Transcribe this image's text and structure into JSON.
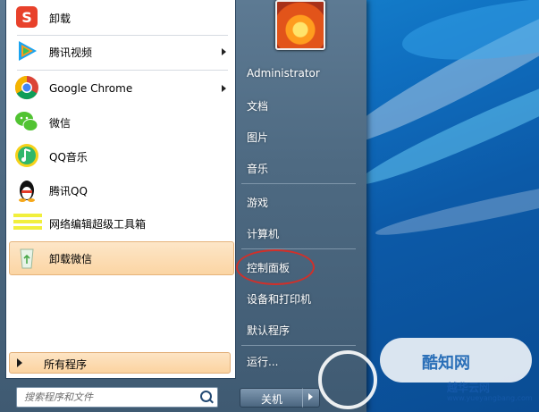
{
  "left_pane": {
    "programs": [
      {
        "label": "卸载",
        "icon": "sogou-uninstall-icon",
        "has_submenu": false
      },
      {
        "label": "腾讯视频",
        "icon": "tencent-video-icon",
        "has_submenu": true
      },
      {
        "label": "Google Chrome",
        "icon": "chrome-icon",
        "has_submenu": true
      },
      {
        "label": "微信",
        "icon": "wechat-icon",
        "has_submenu": false
      },
      {
        "label": "QQ音乐",
        "icon": "qq-music-icon",
        "has_submenu": false
      },
      {
        "label": "腾讯QQ",
        "icon": "qq-penguin-icon",
        "has_submenu": false
      },
      {
        "label": "网络编辑超级工具箱",
        "icon": "toolbox-icon",
        "has_submenu": false
      },
      {
        "label": "卸载微信",
        "icon": "recycle-bin-icon",
        "has_submenu": false,
        "selected": true
      }
    ],
    "all_programs_label": "所有程序",
    "search_placeholder": "搜索程序和文件"
  },
  "right_pane": {
    "user_name": "Administrator",
    "links": [
      "文档",
      "图片",
      "音乐",
      "游戏",
      "计算机",
      "控制面板",
      "设备和打印机",
      "默认程序",
      "运行..."
    ],
    "highlighted_link": "控制面板",
    "shutdown_label": "关机"
  },
  "watermark": {
    "brand": "酷知网",
    "site_name": "越华云网",
    "site_url": "www.yueyangbang.com"
  },
  "colors": {
    "highlight_ring": "#d0302a",
    "selected_item_bg": "#fbd5a4",
    "desktop_blue": "#0f6fc0"
  }
}
